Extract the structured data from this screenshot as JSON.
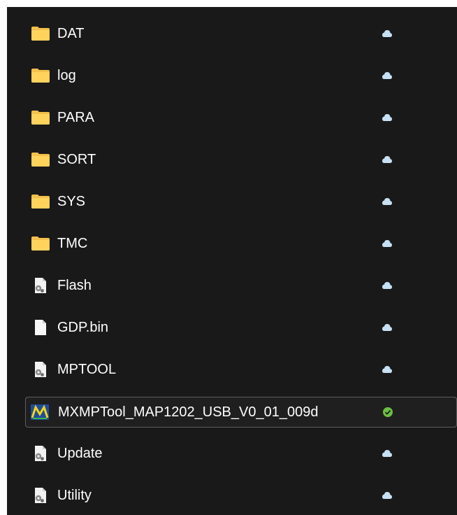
{
  "files": [
    {
      "name": "DAT",
      "icon": "folder-icon",
      "status": "cloud-icon"
    },
    {
      "name": "log",
      "icon": "folder-icon",
      "status": "cloud-icon"
    },
    {
      "name": "PARA",
      "icon": "folder-icon",
      "status": "cloud-icon"
    },
    {
      "name": "SORT",
      "icon": "folder-icon",
      "status": "cloud-icon"
    },
    {
      "name": "SYS",
      "icon": "folder-icon",
      "status": "cloud-icon"
    },
    {
      "name": "TMC",
      "icon": "folder-icon",
      "status": "cloud-icon"
    },
    {
      "name": "Flash",
      "icon": "config-file-icon",
      "status": "cloud-icon"
    },
    {
      "name": "GDP.bin",
      "icon": "blank-file-icon",
      "status": "cloud-icon"
    },
    {
      "name": "MPTOOL",
      "icon": "config-file-icon",
      "status": "cloud-icon"
    },
    {
      "name": "MXMPTool_MAP1202_USB_V0_01_009d",
      "icon": "app-icon",
      "status": "available-check-icon",
      "selected": true
    },
    {
      "name": "Update",
      "icon": "config-file-icon",
      "status": "cloud-icon"
    },
    {
      "name": "Utility",
      "icon": "config-file-icon",
      "status": "cloud-icon"
    }
  ],
  "colors": {
    "background": "#191919",
    "folder": "#f3c04a",
    "cloud": "#c7e0f4",
    "check": "#6cbf43"
  }
}
